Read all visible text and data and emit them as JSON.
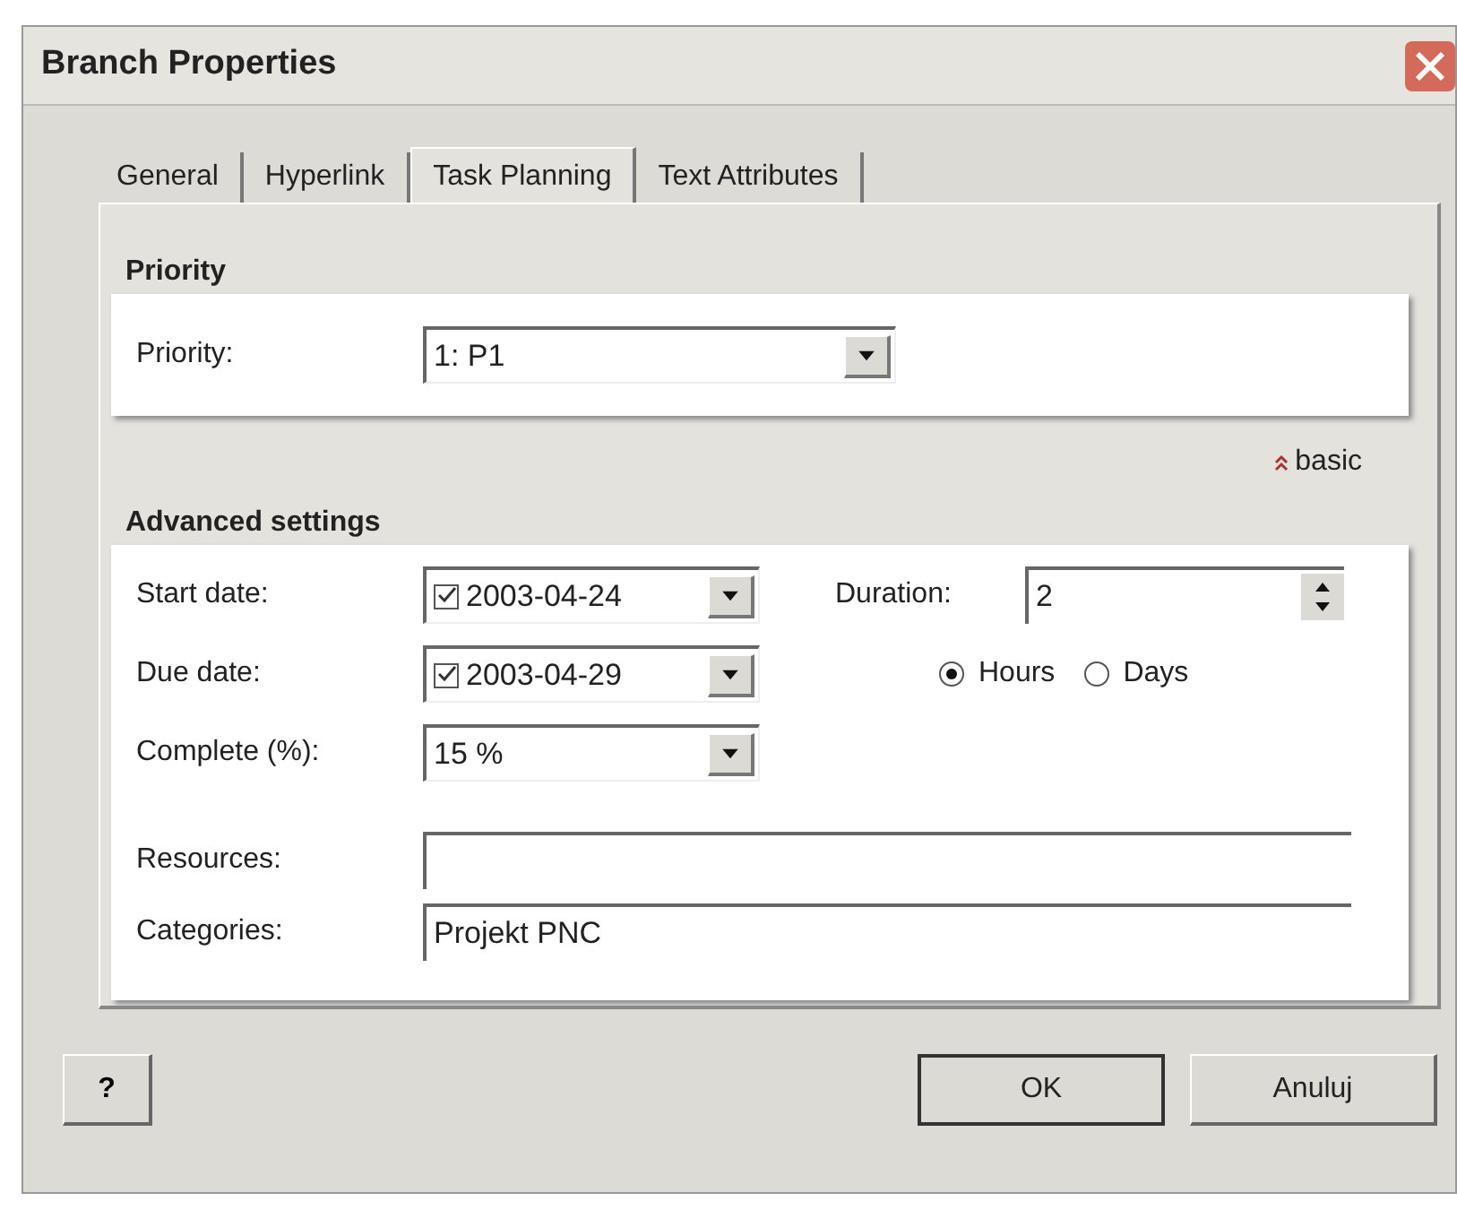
{
  "window": {
    "title": "Branch Properties"
  },
  "tabs": [
    {
      "label": "General",
      "selected": false
    },
    {
      "label": "Hyperlink",
      "selected": false
    },
    {
      "label": "Task Planning",
      "selected": true
    },
    {
      "label": "Text Attributes",
      "selected": false
    }
  ],
  "priority_section": {
    "heading": "Priority",
    "label": "Priority:",
    "value": "1: P1"
  },
  "toggle_link": "basic",
  "advanced_section": {
    "heading": "Advanced settings",
    "start_date": {
      "label": "Start date:",
      "checked": true,
      "value": "2003-04-24"
    },
    "due_date": {
      "label": "Due date:",
      "checked": true,
      "value": "2003-04-29"
    },
    "complete": {
      "label": "Complete (%):",
      "value": "15 %"
    },
    "duration": {
      "label": "Duration:",
      "value": "2"
    },
    "duration_units": [
      {
        "label": "Hours",
        "selected": true
      },
      {
        "label": "Days",
        "selected": false
      }
    ],
    "resources": {
      "label": "Resources:"
    },
    "categories": {
      "label": "Categories:",
      "value": "Projekt PNC"
    }
  },
  "help_button": "?",
  "buttons": [
    "OK",
    "Anuluj"
  ]
}
